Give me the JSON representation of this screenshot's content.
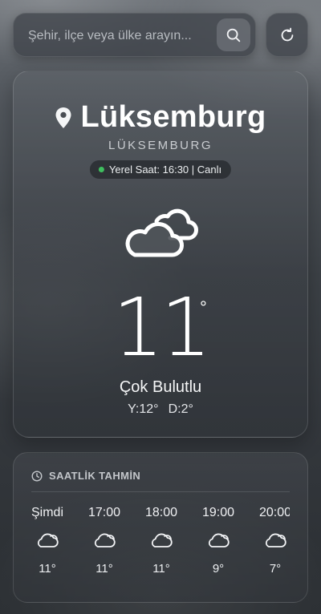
{
  "search": {
    "placeholder": "Şehir, ilçe veya ülke arayın..."
  },
  "icons": {
    "search": "search-icon",
    "refresh": "refresh-icon",
    "location": "location-pin-icon",
    "main_weather": "cloudy-icon",
    "clock": "clock-icon",
    "hourly_weather": "cloud-icon"
  },
  "location": {
    "city": "Lüksemburg",
    "country": "LÜKSEMBURG",
    "local_time_text": "Yerel Saat: 16:30 | Canlı"
  },
  "current": {
    "temperature": "11",
    "unit": "°",
    "condition": "Çok Bulutlu",
    "high": "Y:12°",
    "low": "D:2°"
  },
  "hourly": {
    "title": "SAATLİK TAHMİN",
    "items": [
      {
        "time": "Şimdi",
        "temp": "11°"
      },
      {
        "time": "17:00",
        "temp": "11°"
      },
      {
        "time": "18:00",
        "temp": "11°"
      },
      {
        "time": "19:00",
        "temp": "9°"
      },
      {
        "time": "20:00",
        "temp": "7°"
      }
    ]
  },
  "colors": {
    "live_indicator": "#3fbf5f"
  }
}
